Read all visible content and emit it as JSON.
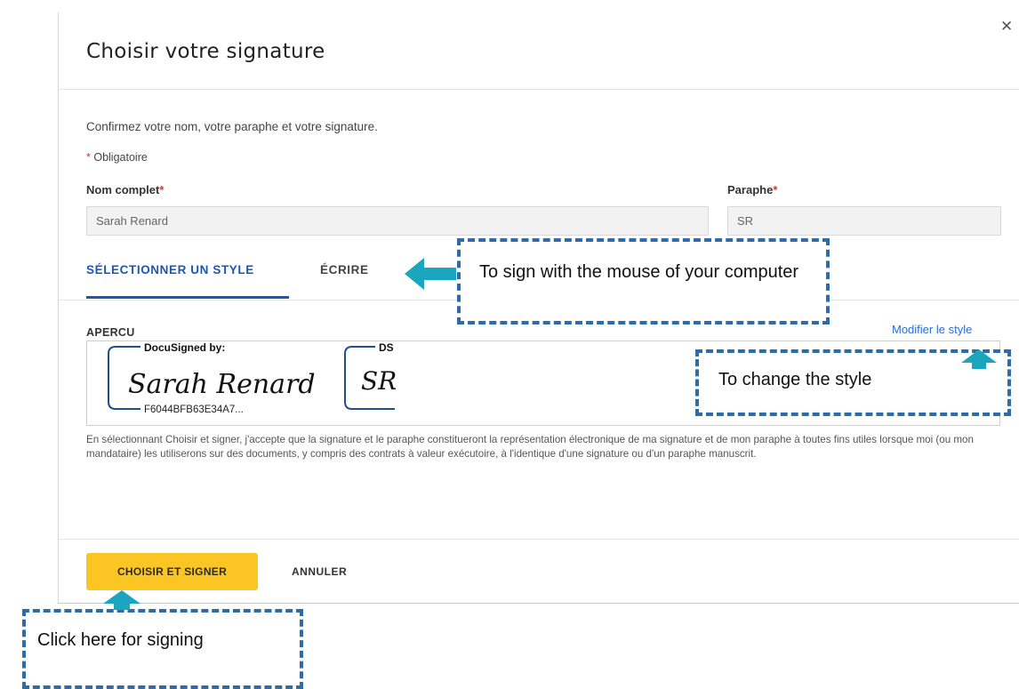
{
  "dialog": {
    "title": "Choisir votre signature",
    "close_icon": "close-icon",
    "instruction": "Confirmez votre nom, votre paraphe et votre signature.",
    "required_note": "Obligatoire",
    "required_mark": "*"
  },
  "fields": {
    "full_name": {
      "label": "Nom complet",
      "value": "Sarah Renard"
    },
    "initials": {
      "label": "Paraphe",
      "value": "SR"
    }
  },
  "tabs": [
    {
      "label": "SÉLECTIONNER UN STYLE",
      "active": true
    },
    {
      "label": "ÉCRIRE",
      "active": false
    }
  ],
  "preview": {
    "label": "APERCU",
    "modify_link": "Modifier le style",
    "signature": {
      "header": "DocuSigned by:",
      "name": "Sarah Renard",
      "id": "F6044BFB63E34A7..."
    },
    "initials": {
      "header": "DS",
      "text": "SR"
    },
    "frame_color": "#1f4f8f"
  },
  "legal_text": "En sélectionnant Choisir et signer, j'accepte que la signature et le paraphe constitueront la représentation électronique de ma signature et de mon paraphe à toutes fins utiles lorsque moi (ou mon mandataire) les utiliserons sur des documents, y compris des contrats à valeur exécutoire, à l'identique d'une signature ou d'un paraphe manuscrit.",
  "buttons": {
    "primary": "CHOISIR ET SIGNER",
    "secondary": "ANNULER"
  },
  "callouts": {
    "draw": "To sign with the mouse of your computer",
    "style": "To change the style",
    "sign": "Click here for signing"
  },
  "colors": {
    "accent_blue": "#1a57b8",
    "primary_button": "#fbc524",
    "callout_border": "#2e6ca8",
    "arrow_fill": "#1ba6bf"
  }
}
